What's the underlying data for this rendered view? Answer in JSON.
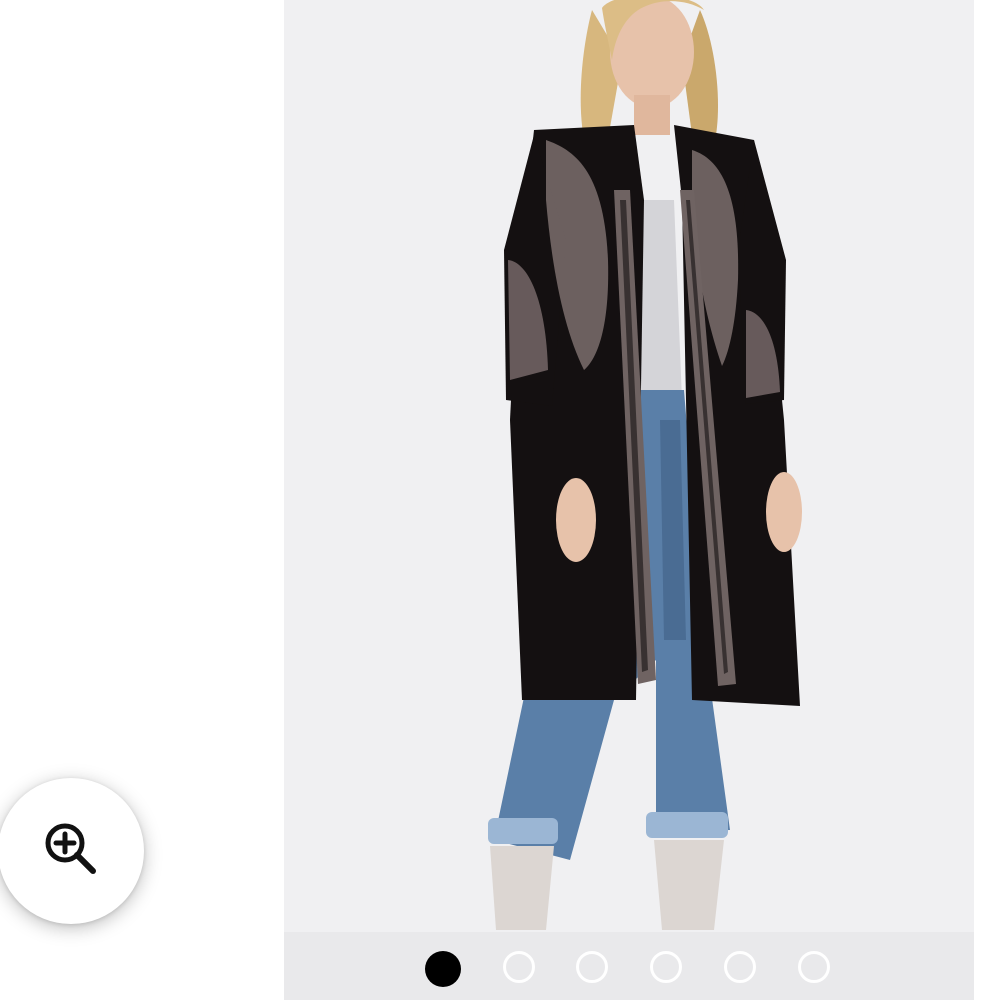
{
  "product_image": {
    "alt": "",
    "colors": {
      "backdrop": "#f0f0f2",
      "coat": "#141011",
      "embroidery": "#8a7b7a",
      "denim": "#5a7fa8",
      "tank": "#d4d4d8",
      "skin": "#e7c2aa",
      "hair": "#d7b77e"
    }
  },
  "zoom_button": {
    "icon": "zoom-in-icon",
    "aria_label": "Zoom"
  },
  "carousel": {
    "total": 6,
    "active_index": 0,
    "active_color": "#000000",
    "inactive_color": "#ffffff"
  }
}
